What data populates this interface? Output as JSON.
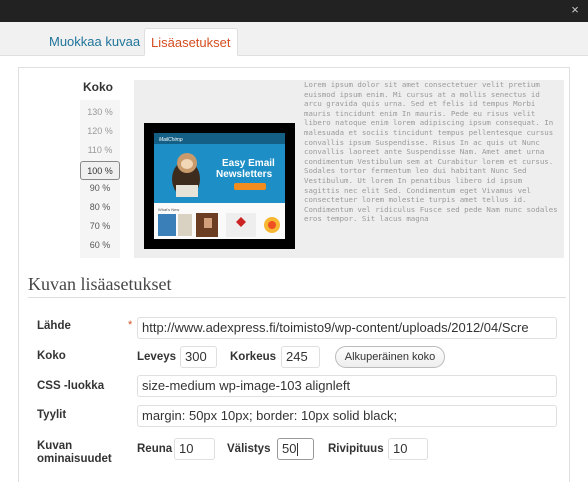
{
  "tabs": [
    {
      "label": "Muokkaa kuvaa",
      "active": false
    },
    {
      "label": "Lisäasetukset",
      "active": true
    }
  ],
  "size_panel": {
    "label": "Koko",
    "zoom_options": [
      "130 %",
      "120 %",
      "110 %",
      "100 %",
      "90 %",
      "80 %",
      "70 %",
      "60 %"
    ],
    "selected": "100 %"
  },
  "preview": {
    "image": {
      "brand": "MailChimp",
      "headline_line1": "Easy Email",
      "headline_line2": "Newsletters",
      "section": "What's New"
    },
    "lorem": "Lorem ipsum dolor sit amet consectetuer velit pretium euismod ipsum enim. Mi cursus at a mollis senectus id arcu gravida quis urna. Sed et felis id tempus Morbi mauris tincidunt enim In mauris. Pede eu risus velit libero natoque enim lorem adipiscing ipsum consequat. In malesuada et sociis tincidunt tempus pellentesque cursus convallis ipsum Suspendisse. Risus In ac quis ut Nunc convallis laoreet ante Suspendisse Nam. Amet amet urna condimentum Vestibulum sem at Curabitur lorem et cursus. Sodales tortor fermentum leo dui habitant Nunc Sed Vestibulum. Ut lorem In penatibus libero id ipsum sagittis nec elit Sed. Condimentum eget Vivamus vel consectetuer lorem molestie turpis amet tellus id. Condimentum vel ridiculus Fusce sed pede Nam nunc sodales eros tempor. Sit lacus magna"
  },
  "section_title": "Kuvan lisäasetukset",
  "fields": {
    "source": {
      "label": "Lähde",
      "required_mark": "*",
      "value": "http://www.adexpress.fi/toimisto9/wp-content/uploads/2012/04/Scre"
    },
    "size": {
      "label": "Koko",
      "width_label": "Leveys",
      "width": "300",
      "height_label": "Korkeus",
      "height": "245",
      "original_button": "Alkuperäinen koko"
    },
    "css_class": {
      "label": "CSS -luokka",
      "value": "size-medium wp-image-103 alignleft"
    },
    "styles": {
      "label": "Tyylit",
      "value": "margin: 50px 10px; border: 10px solid black;"
    },
    "properties": {
      "label_line1": "Kuvan",
      "label_line2": "ominaisuudet",
      "border_label": "Reuna",
      "border": "10",
      "spacing_label": "Välistys",
      "spacing": "50",
      "line_height_label": "Rivipituus",
      "line_height": "10"
    }
  },
  "colors": {
    "link": "#21759b",
    "active_tab": "#d54e21",
    "topbar": "#222222"
  },
  "icons": {
    "close": "close-icon"
  }
}
